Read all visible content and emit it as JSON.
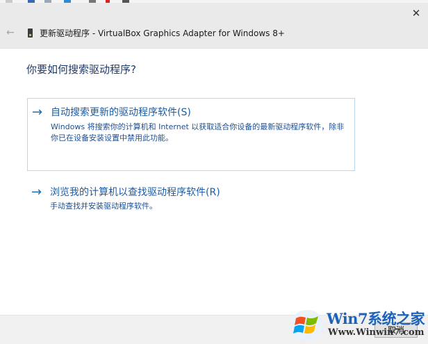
{
  "window": {
    "title": "更新驱动程序 - VirtualBox Graphics Adapter for Windows 8+",
    "close_glyph": "✕",
    "back_glyph": "←"
  },
  "main": {
    "question": "你要如何搜索驱动程序?",
    "options": [
      {
        "arrow": "→",
        "title": "自动搜索更新的驱动程序软件(S)",
        "description": "Windows 将搜索你的计算机和 Internet 以获取适合你设备的最新驱动程序软件，除非你已在设备安装设置中禁用此功能。"
      },
      {
        "arrow": "→",
        "title": "浏览我的计算机以查找驱动程序软件(R)",
        "description": "手动查找并安装驱动程序软件。"
      }
    ]
  },
  "footer": {
    "cancel_label": "取消"
  },
  "watermark": {
    "brand": "Win7系统之家",
    "url": "Www.Winwin7.com"
  },
  "colors": {
    "link_blue": "#1b5ca7",
    "heading_blue": "#1e3a68",
    "titlebar_bg": "#eaeaea",
    "selection_border": "#b8d6ec"
  }
}
